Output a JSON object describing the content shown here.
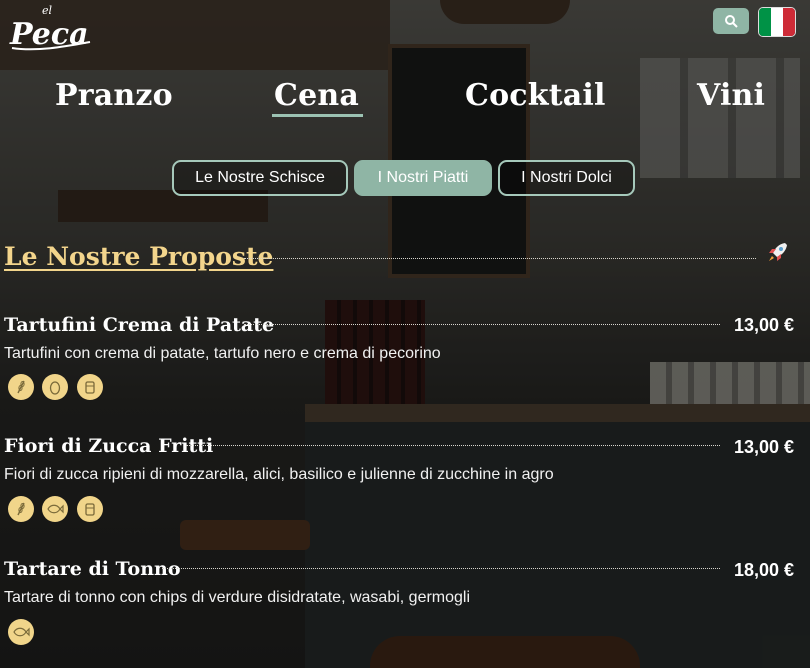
{
  "brand": {
    "logo_text": "Peca",
    "logo_sup": "el"
  },
  "header": {
    "search_icon": "search-icon",
    "language_flag": "italian-flag"
  },
  "main_nav": [
    {
      "label": "Pranzo",
      "active": false
    },
    {
      "label": "Cena",
      "active": true
    },
    {
      "label": "Cocktail",
      "active": false
    },
    {
      "label": "Vini",
      "active": false
    }
  ],
  "sub_tabs": [
    {
      "label": "Le Nostre Schisce",
      "active": false
    },
    {
      "label": "I Nostri Piatti",
      "active": true
    },
    {
      "label": "I Nostri Dolci",
      "active": false
    }
  ],
  "section": {
    "title": "Le Nostre Proposte",
    "icon": "rocket-icon"
  },
  "dishes": [
    {
      "name": "Tartufini Crema di Patate",
      "price": "13,00 €",
      "description": "Tartufini con crema di patate, tartufo nero e crema di pecorino",
      "allergens": [
        "gluten-icon",
        "egg-icon",
        "milk-icon"
      ]
    },
    {
      "name": "Fiori di Zucca Fritti",
      "price": "13,00 €",
      "description": "Fiori di zucca ripieni di mozzarella, alici, basilico e julienne di zucchine in agro",
      "allergens": [
        "gluten-icon",
        "fish-icon",
        "milk-icon"
      ]
    },
    {
      "name": "Tartare di Tonno",
      "price": "18,00 €",
      "description": "Tartare di tonno con chips di verdure disidratate, wasabi, germogli",
      "allergens": [
        "fish-icon"
      ]
    }
  ],
  "colors": {
    "accent": "#8fb5a5",
    "section_title": "#f3d58c",
    "allergen_badge": "#f1d58a",
    "flag_green": "#009246",
    "flag_white": "#ffffff",
    "flag_red": "#ce2b37"
  }
}
